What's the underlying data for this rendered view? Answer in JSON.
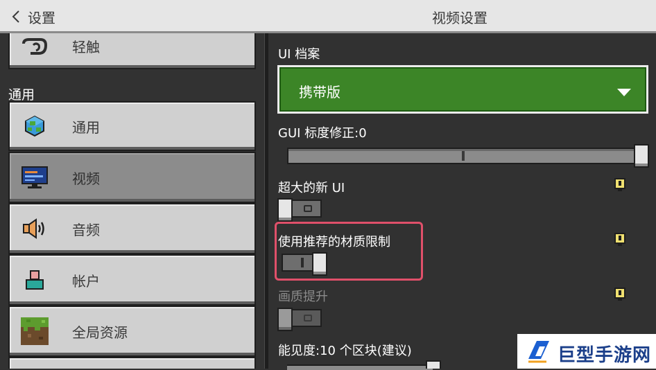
{
  "header": {
    "back_label": "设置",
    "title": "视频设置"
  },
  "sidebar": {
    "partial_item": "轻触",
    "section_label": "通用",
    "items": [
      {
        "label": "通用",
        "icon": "globe-icon"
      },
      {
        "label": "视频",
        "icon": "monitor-icon",
        "active": true
      },
      {
        "label": "音频",
        "icon": "speaker-icon"
      },
      {
        "label": "帐户",
        "icon": "account-icon"
      },
      {
        "label": "全局资源",
        "icon": "grass-block-icon"
      }
    ]
  },
  "settings": {
    "ui_profile": {
      "label": "UI 档案",
      "value": "携带版"
    },
    "gui_scale": {
      "label": "GUI 标度修正:0",
      "value": 0
    },
    "extra_large_ui": {
      "label": "超大的新 UI",
      "enabled": false
    },
    "recommended_texture_limit": {
      "label": "使用推荐的材质限制",
      "enabled": true
    },
    "graphics_upgrade": {
      "label": "画质提升",
      "enabled": false,
      "disabled": true
    },
    "render_distance": {
      "label": "能见度:10 个区块(建议)"
    }
  },
  "watermark": {
    "text": "巨型手游网"
  },
  "colors": {
    "accent_green": "#3c8527",
    "highlight_border": "#e0506a",
    "header_bg": "#e6e6e6"
  }
}
